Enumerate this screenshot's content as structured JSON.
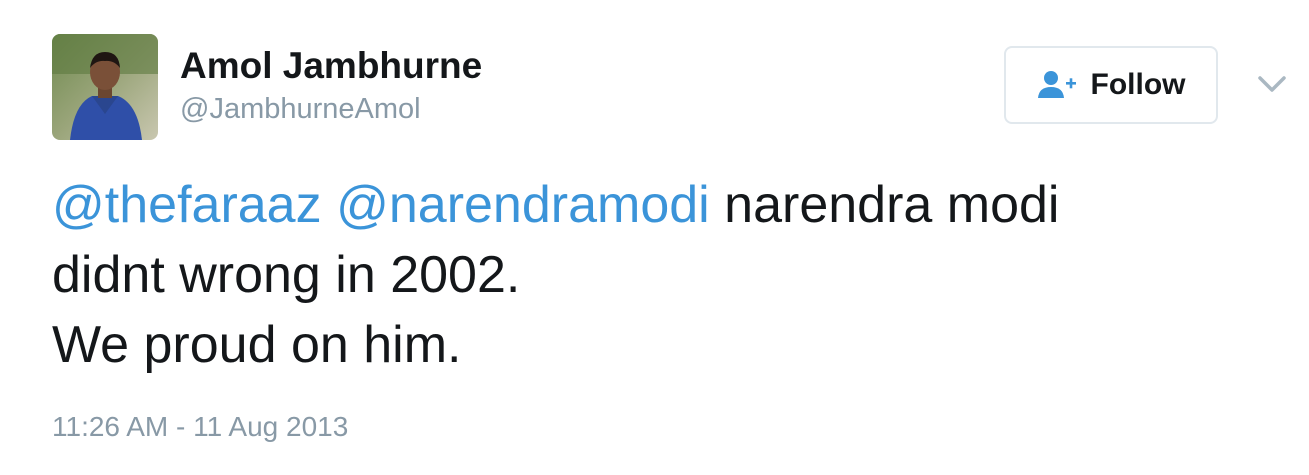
{
  "user": {
    "name": "Amol Jambhurne",
    "handle": "@JambhurneAmol",
    "avatar_icon": "profile-photo"
  },
  "follow_button": {
    "label": "Follow",
    "icon": "add-user-icon"
  },
  "menu": {
    "icon": "chevron-down-icon"
  },
  "tweet": {
    "mention_1": "@thefaraaz",
    "mention_2": "@narendramodi",
    "text_line_1": " narendra modi",
    "text_line_2": "didnt wrong in 2002.",
    "text_line_3": "We proud on him."
  },
  "timestamp": "11:26 AM - 11 Aug 2013",
  "colors": {
    "link": "#3b94d9",
    "secondary_text": "#8899a6",
    "primary_text": "#14171a",
    "button_border": "#e1e8ed"
  }
}
